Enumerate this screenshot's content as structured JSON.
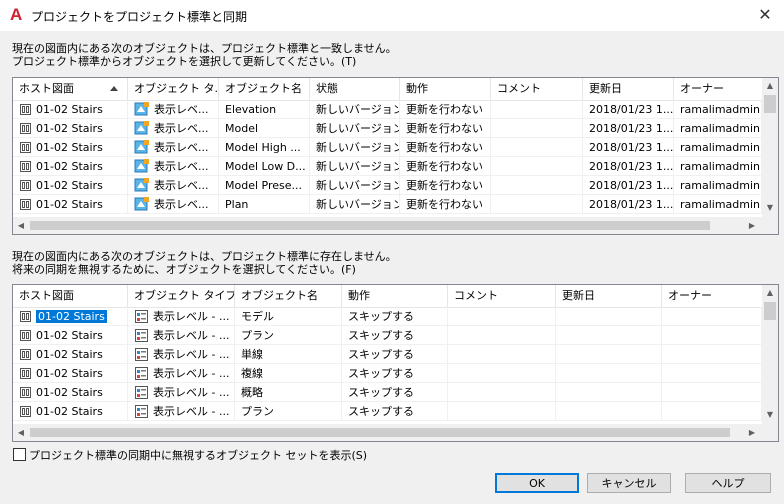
{
  "window": {
    "title": "プロジェクトをプロジェクト標準と同期",
    "app_icon_letter": "A",
    "close_glyph": "✕"
  },
  "section1": {
    "desc_line1": "現在の図面内にある次のオブジェクトは、プロジェクト標準と一致しません。",
    "desc_line2": "プロジェクト標準からオブジェクトを選択して更新してください。(T)",
    "columns": [
      "ホスト図面",
      "オブジェクト タ...",
      "オブジェクト名",
      "状態",
      "動作",
      "コメント",
      "更新日",
      "オーナー"
    ],
    "rows": [
      {
        "host": "01-02 Stairs",
        "type": "表示レベ...",
        "name": "Elevation",
        "status": "新しいバージョン",
        "action": "更新を行わない",
        "comment": "",
        "date": "2018/01/23 1...",
        "owner": "ramalimadmin"
      },
      {
        "host": "01-02 Stairs",
        "type": "表示レベ...",
        "name": "Model",
        "status": "新しいバージョン",
        "action": "更新を行わない",
        "comment": "",
        "date": "2018/01/23 1...",
        "owner": "ramalimadmin"
      },
      {
        "host": "01-02 Stairs",
        "type": "表示レベ...",
        "name": "Model High ...",
        "status": "新しいバージョン",
        "action": "更新を行わない",
        "comment": "",
        "date": "2018/01/23 1...",
        "owner": "ramalimadmin"
      },
      {
        "host": "01-02 Stairs",
        "type": "表示レベ...",
        "name": "Model Low D...",
        "status": "新しいバージョン",
        "action": "更新を行わない",
        "comment": "",
        "date": "2018/01/23 1...",
        "owner": "ramalimadmin"
      },
      {
        "host": "01-02 Stairs",
        "type": "表示レベ...",
        "name": "Model Prese...",
        "status": "新しいバージョン",
        "action": "更新を行わない",
        "comment": "",
        "date": "2018/01/23 1...",
        "owner": "ramalimadmin"
      },
      {
        "host": "01-02 Stairs",
        "type": "表示レベ...",
        "name": "Plan",
        "status": "新しいバージョン",
        "action": "更新を行わない",
        "comment": "",
        "date": "2018/01/23 1...",
        "owner": "ramalimadmin"
      }
    ]
  },
  "section2": {
    "desc_line1": "現在の図面内にある次のオブジェクトは、プロジェクト標準に存在しません。",
    "desc_line2": "将来の同期を無視するために、オブジェクトを選択してください。(F)",
    "columns": [
      "ホスト図面",
      "オブジェクト タイプ",
      "オブジェクト名",
      "動作",
      "コメント",
      "更新日",
      "オーナー"
    ],
    "rows": [
      {
        "host": "01-02 Stairs",
        "type": "表示レベル - ...",
        "name": "モデル",
        "action": "スキップする",
        "comment": "",
        "date": "",
        "owner": ""
      },
      {
        "host": "01-02 Stairs",
        "type": "表示レベル - ...",
        "name": "プラン",
        "action": "スキップする",
        "comment": "",
        "date": "",
        "owner": ""
      },
      {
        "host": "01-02 Stairs",
        "type": "表示レベル - ...",
        "name": "単線",
        "action": "スキップする",
        "comment": "",
        "date": "",
        "owner": ""
      },
      {
        "host": "01-02 Stairs",
        "type": "表示レベル - ...",
        "name": "複線",
        "action": "スキップする",
        "comment": "",
        "date": "",
        "owner": ""
      },
      {
        "host": "01-02 Stairs",
        "type": "表示レベル - ...",
        "name": "概略",
        "action": "スキップする",
        "comment": "",
        "date": "",
        "owner": ""
      },
      {
        "host": "01-02 Stairs",
        "type": "表示レベル - ...",
        "name": "プラン",
        "action": "スキップする",
        "comment": "",
        "date": "",
        "owner": ""
      }
    ]
  },
  "options": {
    "show_ignored_label": "プロジェクト標準の同期中に無視するオブジェクト セットを表示(S)",
    "show_ignored_checked": false
  },
  "buttons": {
    "ok": "OK",
    "cancel": "キャンセル",
    "help": "ヘルプ"
  },
  "scroll_glyphs": {
    "up": "▲",
    "down": "▼",
    "left": "◀",
    "right": "▶"
  }
}
